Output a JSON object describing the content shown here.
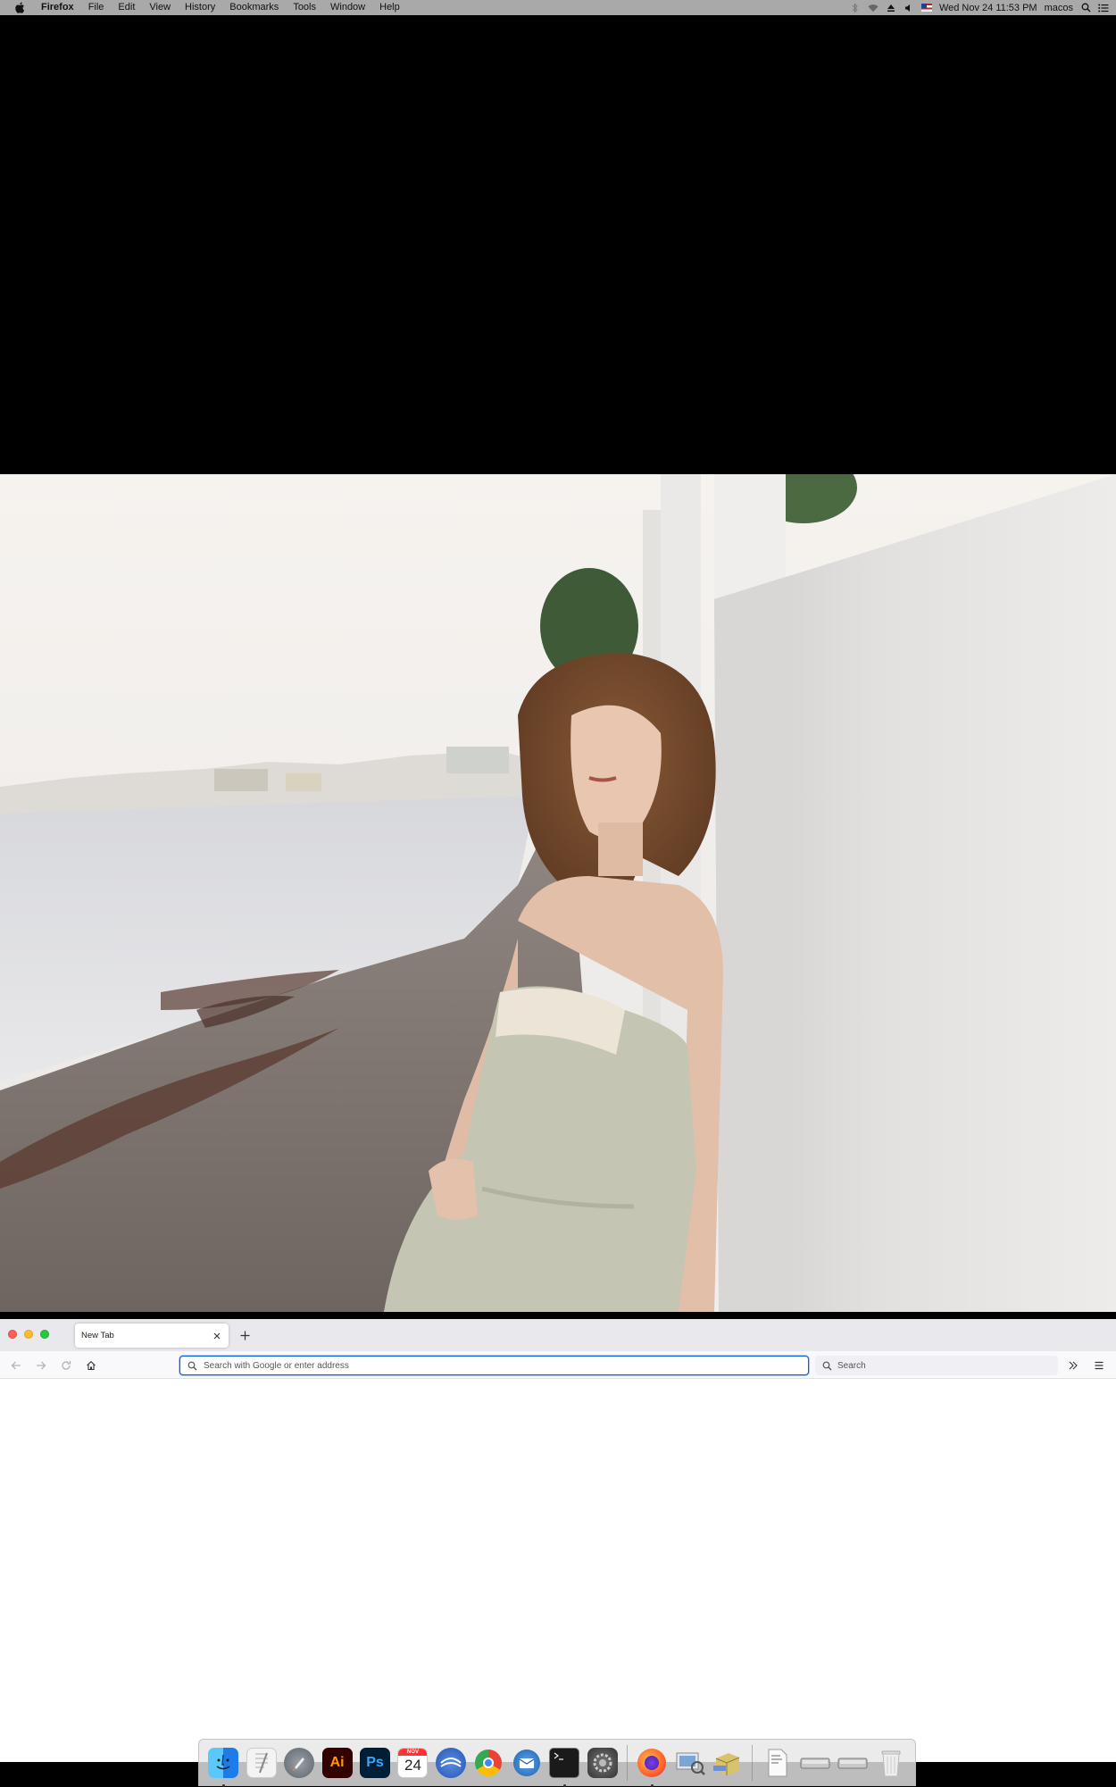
{
  "menubar": {
    "app_name": "Firefox",
    "menus": [
      "File",
      "Edit",
      "View",
      "History",
      "Bookmarks",
      "Tools",
      "Window",
      "Help"
    ],
    "clock": "Wed Nov 24  11:53 PM",
    "user": "macos",
    "status_icons": [
      "bluetooth-icon",
      "wifi-icon",
      "eject-icon",
      "volume-icon",
      "flag-icon",
      "spotlight-icon",
      "control-center-icon"
    ]
  },
  "browser": {
    "tab": {
      "title": "New Tab"
    },
    "urlbar": {
      "placeholder": "Search with Google or enter address"
    },
    "searchbar": {
      "placeholder": "Search"
    }
  },
  "dock": {
    "apps": [
      {
        "name": "Finder",
        "icon": "finder-icon",
        "running": true
      },
      {
        "name": "TextEdit",
        "icon": "textedit-icon",
        "running": false
      },
      {
        "name": "Launchpad",
        "icon": "launchpad-icon",
        "running": false
      },
      {
        "name": "Adobe Illustrator",
        "icon": "illustrator-icon",
        "label": "Ai",
        "running": false
      },
      {
        "name": "Adobe Photoshop",
        "icon": "photoshop-icon",
        "label": "Ps",
        "running": false
      },
      {
        "name": "Calendar",
        "icon": "calendar-icon",
        "month": "NOV",
        "day": "24",
        "running": false
      },
      {
        "name": "Migration",
        "icon": "migration-icon",
        "running": false
      },
      {
        "name": "Chrome",
        "icon": "chrome-icon",
        "running": false
      },
      {
        "name": "Thunderbird",
        "icon": "thunderbird-icon",
        "running": false
      },
      {
        "name": "Terminal",
        "icon": "terminal-icon",
        "running": true
      },
      {
        "name": "System Preferences",
        "icon": "system-preferences-icon",
        "running": false
      },
      {
        "name": "Firefox",
        "icon": "firefox-icon",
        "running": true
      },
      {
        "name": "Preview",
        "icon": "preview-icon",
        "running": false
      },
      {
        "name": "Archive Utility",
        "icon": "archive-icon",
        "running": false
      },
      {
        "name": "Document",
        "icon": "document-icon",
        "running": false
      },
      {
        "name": "Drives",
        "icon": "drives-icon",
        "running": false
      },
      {
        "name": "Trash",
        "icon": "trash-icon",
        "running": false
      }
    ]
  },
  "colors": {
    "menubar_bg": "#a9a9a9",
    "url_focus": "#0060df",
    "tabbar_bg": "#e9e9ed",
    "navbar_bg": "#f9f9fb"
  }
}
